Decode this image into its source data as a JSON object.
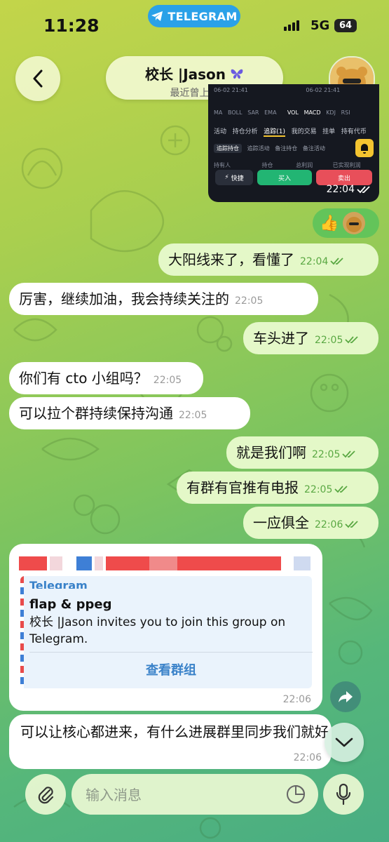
{
  "status_bar": {
    "time": "11:28",
    "pill_label": "TELEGRAM",
    "network": "5G",
    "battery": "64"
  },
  "header": {
    "name": "校长 |Jason",
    "subtitle": "最近曾上线"
  },
  "image_message": {
    "indicator_row": [
      "MA",
      "BOLL",
      "SAR",
      "EMA",
      "VOL",
      "MACD",
      "KDJ",
      "RSI"
    ],
    "dates": [
      "06-02 21:41",
      "06-02 21:41"
    ],
    "tabs": [
      "活动",
      "持仓分析",
      "追踪(1)",
      "我的交易",
      "挂单",
      "持有代币"
    ],
    "subtabs": [
      "追踪持仓",
      "追踪活动",
      "备注持仓",
      "备注活动"
    ],
    "columns": [
      "持有人",
      "持仓",
      "总利润",
      "已实现利润"
    ],
    "buttons": {
      "quick": "快捷",
      "buy": "买入",
      "sell": "卖出"
    },
    "time": "22:04"
  },
  "reaction": {
    "emoji": "👍"
  },
  "messages": [
    {
      "text": "大阳线来了，看懂了",
      "time": "22:04"
    },
    {
      "text": "厉害，继续加油，我会持续关注的",
      "time": "22:05"
    },
    {
      "text": "车头进了",
      "time": "22:05"
    },
    {
      "text": "你们有 cto 小组吗？",
      "time": "22:05"
    },
    {
      "text": "可以拉个群持续保持沟通",
      "time": "22:05"
    },
    {
      "text": "就是我们啊",
      "time": "22:05"
    },
    {
      "text": "有群有官推有电报",
      "time": "22:05"
    },
    {
      "text": "一应俱全",
      "time": "22:06"
    }
  ],
  "link_card": {
    "site": "Telegram",
    "title": "flap & ppeg",
    "description": "校长 |Jason invites you to join this group on Telegram.",
    "button": "查看群组",
    "time": "22:06"
  },
  "last_message": {
    "text": "可以让核心都进来，有什么进展群里同步我们就好",
    "time": "22:06"
  },
  "composer": {
    "placeholder": "输入消息"
  },
  "colors": {
    "accent": "#3a82c9",
    "out_bubble": "#e4f8c8",
    "in_bubble": "#ffffff",
    "pill": "#2aa1e8"
  }
}
